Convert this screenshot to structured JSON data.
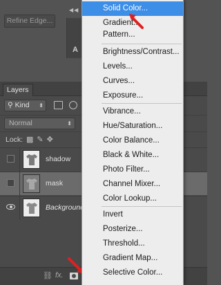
{
  "topbar": {
    "refine_edge_label": "Refine Edge..."
  },
  "layers_panel": {
    "tab_label": "Layers",
    "kind_filter": "Kind",
    "blend_mode": "Normal",
    "lock_label": "Lock:",
    "layers": [
      {
        "name": "shadow",
        "visible": false,
        "selected": false
      },
      {
        "name": "mask",
        "visible": false,
        "selected": true
      },
      {
        "name": "Background",
        "visible": true,
        "selected": false
      }
    ],
    "footer_icons": [
      "link-layers-icon",
      "fx-icon",
      "add-mask-icon",
      "new-adjustment-layer-icon",
      "new-group-icon",
      "new-layer-icon",
      "trash-icon"
    ]
  },
  "adjustment_menu": {
    "groups": [
      [
        "Solid Color...",
        "Gradient...",
        "Pattern..."
      ],
      [
        "Brightness/Contrast...",
        "Levels...",
        "Curves...",
        "Exposure..."
      ],
      [
        "Vibrance...",
        "Hue/Saturation...",
        "Color Balance...",
        "Black & White...",
        "Photo Filter...",
        "Channel Mixer...",
        "Color Lookup..."
      ],
      [
        "Invert",
        "Posterize...",
        "Threshold...",
        "Gradient Map...",
        "Selective Color..."
      ]
    ],
    "highlighted": "Solid Color..."
  },
  "colors": {
    "menu_highlight": "#3d8ee6",
    "annotation_arrow": "#e02020",
    "panel_bg": "#4a4a4a"
  }
}
